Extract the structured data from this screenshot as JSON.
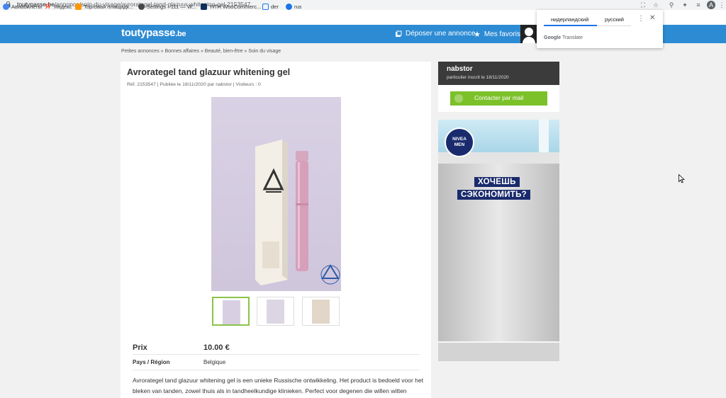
{
  "browser": {
    "url_host": "toutypasse.be",
    "url_path": "/annonce/soin-du-visage/avrorategel-tand-glazuur-whitening-gel-2153547",
    "bookmarks": [
      {
        "label": "Авиабилеты",
        "icon": "bookmark-globe-icon",
        "color": "#4285f4"
      },
      {
        "label": "Яндекс",
        "icon": "yandex-icon",
        "color": "#fc3f1d"
      },
      {
        "label": "Торговая площадк...",
        "icon": "marketplace-icon",
        "color": "#ff9800"
      },
      {
        "label": "Settings ‹ 111 — W...",
        "icon": "wordpress-icon",
        "color": "#464646"
      },
      {
        "label": "YITH WooCommerc...",
        "icon": "yith-icon",
        "color": "#0b2e5c"
      },
      {
        "label": "der",
        "icon": "page-icon",
        "color": "#1a73e8"
      },
      {
        "label": "rus",
        "icon": "globe-icon",
        "color": "#1a73e8"
      }
    ]
  },
  "translate": {
    "source_lang": "нидерландский",
    "target_lang": "русский",
    "brand": "Google",
    "brand_suffix": "Translate"
  },
  "site": {
    "logo": "toutypasse",
    "logo_tld": ".be",
    "post_ad": "Déposer une annonce",
    "favorites": "Mes favoris"
  },
  "breadcrumb": "Petites annonces » Bonnes affaires » Beauté, bien-être » Soin du visage",
  "listing": {
    "title": "Avrorategel tand glazuur whitening gel",
    "meta": "Réf. 2153547 | Publiée le 18/11/2020 par nabstor | Visiteurs : 0",
    "price_label": "Prix",
    "price_value": "10.00 €",
    "country_label": "Pays / Région",
    "country_value": "Belgique",
    "description": "Avrorategel tand glazuur whitening gel is een unieke Russische ontwikkeling. Het product is bedoeld voor het bleken van tanden, zowel thuis als in tandheelkundige klinieken. Perfect voor degenen die willen witten"
  },
  "seller": {
    "name": "nabstor",
    "since": "particulier inscrit le 18/11/2020",
    "contact": "Contacter par mail"
  },
  "ad": {
    "brand_top": "NIVEA",
    "brand_bottom": "MEN",
    "line1": "ХОЧЕШЬ",
    "line2": "СЭКОНОМИТЬ?"
  },
  "colors": {
    "header_blue": "#2d8bd4",
    "contact_green": "#7cc12a",
    "thumb_active": "#8bc34a"
  }
}
